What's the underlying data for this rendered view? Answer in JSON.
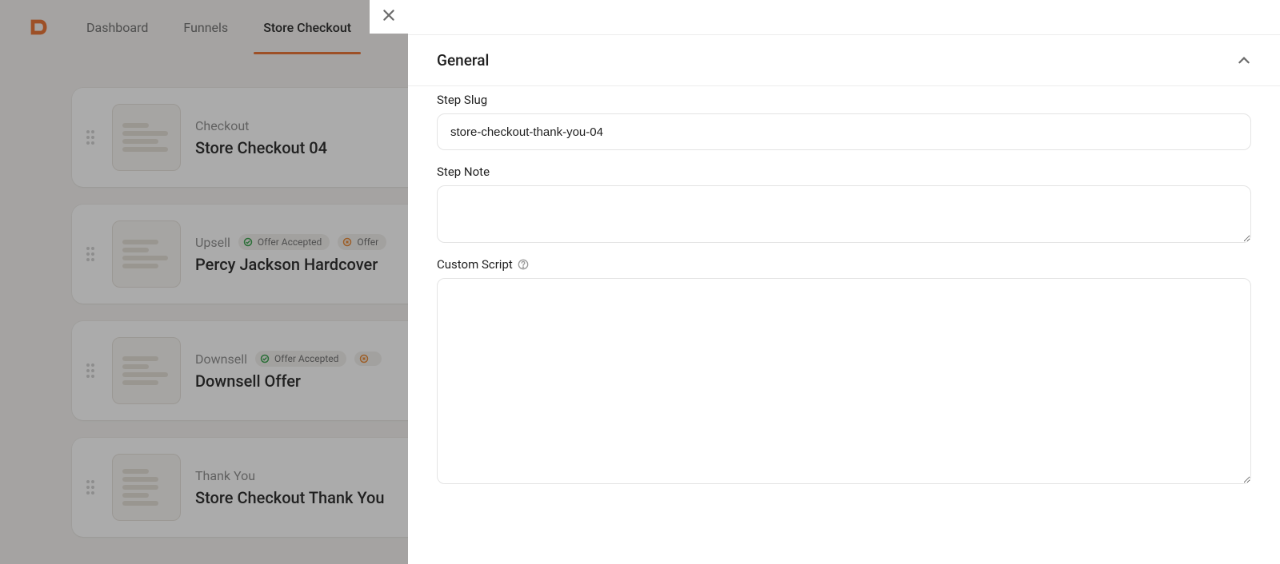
{
  "nav": {
    "items": [
      {
        "label": "Dashboard",
        "active": false
      },
      {
        "label": "Funnels",
        "active": false
      },
      {
        "label": "Store Checkout",
        "active": true
      }
    ]
  },
  "steps": [
    {
      "type": "Checkout",
      "title": "Store Checkout 04",
      "pills": []
    },
    {
      "type": "Upsell",
      "title": "Percy Jackson Hardcover",
      "pills": [
        {
          "kind": "green",
          "text": "Offer Accepted"
        },
        {
          "kind": "orange",
          "text": "Offer"
        }
      ]
    },
    {
      "type": "Downsell",
      "title": "Downsell Offer",
      "pills": [
        {
          "kind": "green",
          "text": "Offer Accepted"
        },
        {
          "kind": "orange",
          "text": ""
        }
      ]
    },
    {
      "type": "Thank You",
      "title": "Store Checkout Thank You",
      "pills": []
    }
  ],
  "panel": {
    "section_title": "General",
    "fields": {
      "slug_label": "Step Slug",
      "slug_value": "store-checkout-thank-you-04",
      "note_label": "Step Note",
      "note_value": "",
      "script_label": "Custom Script",
      "script_value": ""
    }
  }
}
